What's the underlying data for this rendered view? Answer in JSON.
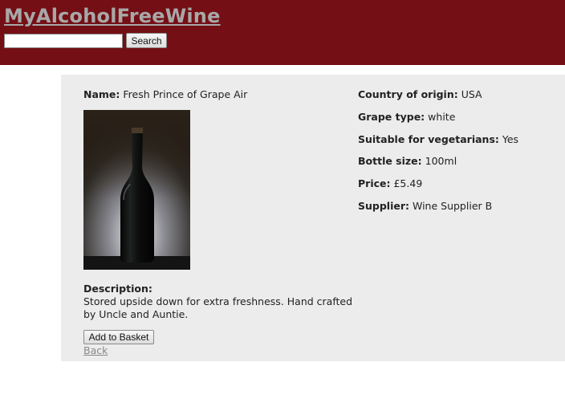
{
  "header": {
    "site_title": "MyAlcoholFreeWine",
    "search_placeholder": "",
    "search_value": "",
    "search_button": "Search"
  },
  "product": {
    "name_label": "Name:",
    "name": "Fresh Prince of Grape Air",
    "image_icon": "wine-bottle",
    "description_label": "Description:",
    "description": "Stored upside down for extra freshness. Hand crafted by Uncle and Auntie.",
    "details": [
      {
        "label": "Country of origin:",
        "value": "USA"
      },
      {
        "label": "Grape type:",
        "value": "white"
      },
      {
        "label": "Suitable for vegetarians:",
        "value": "Yes"
      },
      {
        "label": "Bottle size:",
        "value": "100ml"
      },
      {
        "label": "Price:",
        "value": "£5.49"
      },
      {
        "label": "Supplier:",
        "value": "Wine Supplier B"
      }
    ]
  },
  "actions": {
    "add_to_basket": "Add to Basket",
    "back": "Back"
  },
  "colors": {
    "header_bg": "#740f16",
    "content_bg": "#ececec",
    "title_link": "#a8a8a8"
  }
}
